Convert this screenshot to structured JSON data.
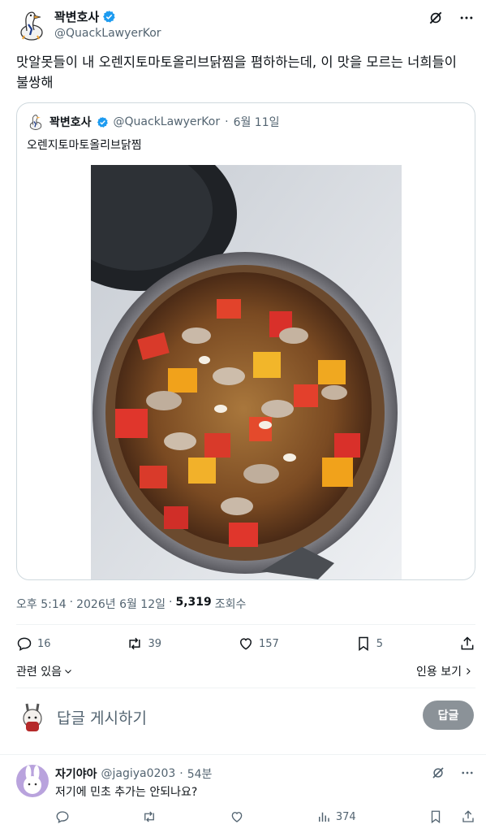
{
  "author": {
    "name": "꽉변호사",
    "handle": "@QuackLawyerKor"
  },
  "tweet": {
    "text": "맛알못들이 내 오렌지토마토올리브닭찜을 폄하하는데, 이 맛을 모르는 너희들이 불쌍해"
  },
  "quoted": {
    "name": "꽉변호사",
    "handle": "@QuackLawyerKor",
    "separator": "·",
    "date": "6월 11일",
    "text": "오렌지토마토올리브닭찜"
  },
  "meta": {
    "time": "오후 5:14",
    "dot1": "·",
    "date": "2026년 6월 12일",
    "dot2": "·",
    "views": "5,319",
    "views_label": "조회수"
  },
  "actions": {
    "replies": "16",
    "retweets": "39",
    "likes": "157",
    "bookmarks": "5"
  },
  "related_label": "관련 있음",
  "translate_label": "인용 보기",
  "reply_box": {
    "placeholder": "답글 게시하기",
    "button": "답글"
  },
  "reply": {
    "name": "자기야아",
    "handle": "@jagiya0203",
    "separator": "·",
    "time": "54분",
    "text": "저기에 민초 추가는 안되나요?",
    "views": "374"
  },
  "colors": {
    "verified": "#1d9bf0",
    "muted": "#536471",
    "reply_button": "#8b9298"
  }
}
